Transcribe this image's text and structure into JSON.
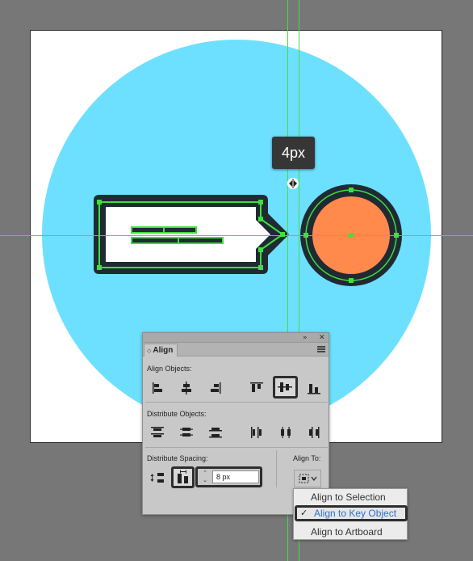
{
  "colors": {
    "workspace": "#777777",
    "artboard": "#ffffff",
    "circle_background": "#6ee0ff",
    "badge_fill": "#ff8a4c",
    "dark_outline": "#1f2a33",
    "selection_green": "#3ee03e",
    "tooltip": "#363636",
    "selected_menu_text": "#2c6fd0"
  },
  "tooltip": {
    "text": "4px"
  },
  "panel": {
    "tab_arrows": "◇",
    "tab_label": "Align",
    "collapse": "»",
    "close": "✕",
    "align_objects_label": "Align Objects:",
    "distribute_objects_label": "Distribute Objects:",
    "distribute_spacing_label": "Distribute Spacing:",
    "align_to_label": "Align To:",
    "spacing_value": "8 px",
    "align_objects_icons": [
      "horizontal-align-left-icon",
      "horizontal-align-center-icon",
      "horizontal-align-right-icon",
      "vertical-align-top-icon",
      "vertical-align-center-icon",
      "vertical-align-bottom-icon"
    ],
    "active_align_icon": "vertical-align-center-icon",
    "distribute_objects_icons": [
      "vertical-distribute-top-icon",
      "vertical-distribute-center-icon",
      "vertical-distribute-bottom-icon",
      "horizontal-distribute-left-icon",
      "horizontal-distribute-center-icon",
      "horizontal-distribute-right-icon"
    ],
    "distribute_spacing_icons": [
      "vertical-distribute-space-icon",
      "horizontal-distribute-space-icon"
    ],
    "active_spacing_icon": "horizontal-distribute-space-icon"
  },
  "dropdown": {
    "items": [
      "Align to Selection",
      "Align to Key Object",
      "Align to Artboard"
    ],
    "selected": "Align to Key Object",
    "check": "✓"
  }
}
